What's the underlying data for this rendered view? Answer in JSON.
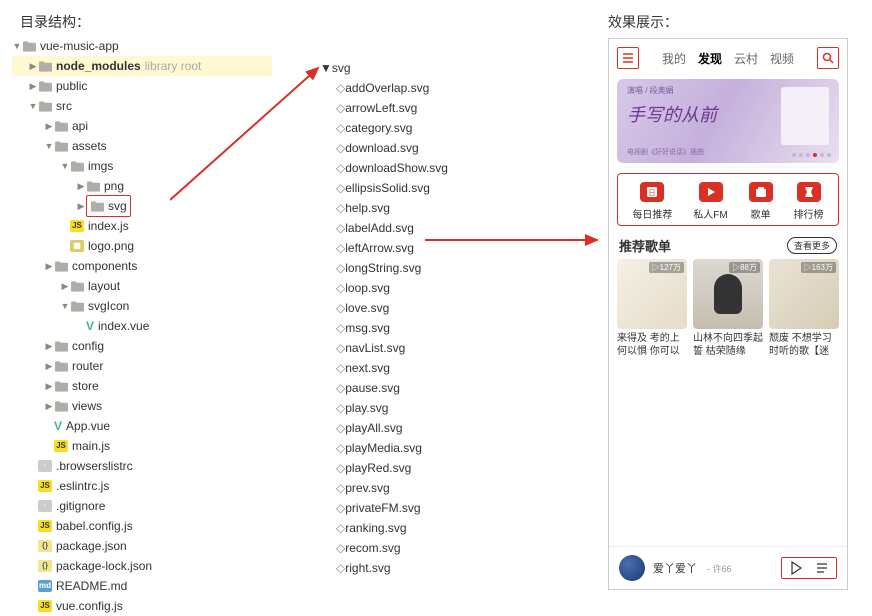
{
  "titles": {
    "left": "目录结构：",
    "right": "效果展示："
  },
  "leftTree": [
    {
      "d": 0,
      "caret": "▼",
      "kind": "folder",
      "label": "vue-music-app"
    },
    {
      "d": 1,
      "caret": "▶",
      "kind": "folder",
      "label": "node_modules",
      "suffix": "library root",
      "hl": true,
      "bold": true
    },
    {
      "d": 1,
      "caret": "▶",
      "kind": "folder",
      "label": "public"
    },
    {
      "d": 1,
      "caret": "▼",
      "kind": "folder",
      "label": "src"
    },
    {
      "d": 2,
      "caret": "▶",
      "kind": "folder",
      "label": "api"
    },
    {
      "d": 2,
      "caret": "▼",
      "kind": "folder",
      "label": "assets"
    },
    {
      "d": 3,
      "caret": "▼",
      "kind": "folder",
      "label": "imgs"
    },
    {
      "d": 4,
      "caret": "▶",
      "kind": "folder",
      "label": "png"
    },
    {
      "d": 4,
      "caret": "▶",
      "kind": "folder",
      "label": "svg",
      "boxed": true
    },
    {
      "d": 3,
      "caret": "",
      "kind": "js",
      "label": "index.js"
    },
    {
      "d": 3,
      "caret": "",
      "kind": "img",
      "label": "logo.png"
    },
    {
      "d": 2,
      "caret": "▶",
      "kind": "folder",
      "label": "components"
    },
    {
      "d": 3,
      "caret": "▶",
      "kind": "folder",
      "label": "layout"
    },
    {
      "d": 3,
      "caret": "▼",
      "kind": "folder",
      "label": "svgIcon"
    },
    {
      "d": 4,
      "caret": "",
      "kind": "vue",
      "label": "index.vue"
    },
    {
      "d": 2,
      "caret": "▶",
      "kind": "folder",
      "label": "config"
    },
    {
      "d": 2,
      "caret": "▶",
      "kind": "folder",
      "label": "router"
    },
    {
      "d": 2,
      "caret": "▶",
      "kind": "folder",
      "label": "store"
    },
    {
      "d": 2,
      "caret": "▶",
      "kind": "folder",
      "label": "views"
    },
    {
      "d": 2,
      "caret": "",
      "kind": "vue",
      "label": "App.vue"
    },
    {
      "d": 2,
      "caret": "",
      "kind": "js",
      "label": "main.js"
    },
    {
      "d": 1,
      "caret": "",
      "kind": "dot",
      "label": ".browserslistrc"
    },
    {
      "d": 1,
      "caret": "",
      "kind": "js",
      "label": ".eslintrc.js"
    },
    {
      "d": 1,
      "caret": "",
      "kind": "dot",
      "label": ".gitignore"
    },
    {
      "d": 1,
      "caret": "",
      "kind": "js",
      "label": "babel.config.js"
    },
    {
      "d": 1,
      "caret": "",
      "kind": "json",
      "label": "package.json"
    },
    {
      "d": 1,
      "caret": "",
      "kind": "json",
      "label": "package-lock.json"
    },
    {
      "d": 1,
      "caret": "",
      "kind": "md",
      "label": "README.md"
    },
    {
      "d": 1,
      "caret": "",
      "kind": "js",
      "label": "vue.config.js"
    }
  ],
  "midTree": {
    "header": {
      "caret": "▼",
      "kind": "folder",
      "label": "svg"
    },
    "files": [
      "addOverlap.svg",
      "arrowLeft.svg",
      "category.svg",
      "download.svg",
      "downloadShow.svg",
      "ellipsisSolid.svg",
      "help.svg",
      "labelAdd.svg",
      "leftArrow.svg",
      "longString.svg",
      "loop.svg",
      "love.svg",
      "msg.svg",
      "navList.svg",
      "next.svg",
      "pause.svg",
      "play.svg",
      "playAll.svg",
      "playMedia.svg",
      "playRed.svg",
      "prev.svg",
      "privateFM.svg",
      "ranking.svg",
      "recom.svg",
      "right.svg"
    ]
  },
  "phone": {
    "tabs": [
      "我的",
      "发现",
      "云村",
      "视频"
    ],
    "activeTab": 1,
    "banner": {
      "sub1": "演唱 / 段奥娟",
      "title": "手写的从前",
      "sub2": "电视剧《好好说话》插曲"
    },
    "quick": [
      {
        "label": "每日推荐"
      },
      {
        "label": "私人FM"
      },
      {
        "label": "歌单"
      },
      {
        "label": "排行榜"
      }
    ],
    "recTitle": "推荐歌单",
    "recMore": "查看更多",
    "recs": [
      {
        "plays": "▷127万",
        "cap": "来得及 考的上 何以惧 你可以"
      },
      {
        "plays": "▷88万",
        "cap": "山林不向四季起誓 枯荣随缘"
      },
      {
        "plays": "▷163万",
        "cap": "颓废 不想学习时听的歌【迷"
      }
    ],
    "playing": {
      "name": "爱丫爱丫",
      "artist": "- 许66"
    }
  }
}
